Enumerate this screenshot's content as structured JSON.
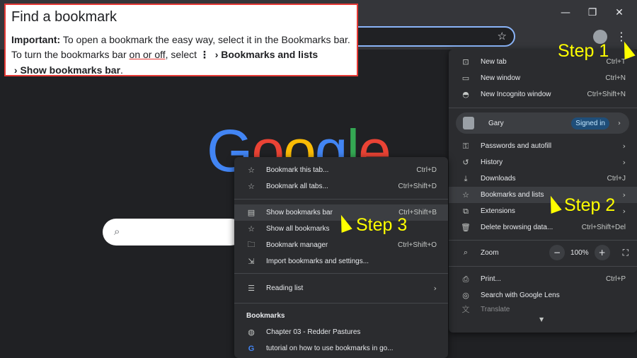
{
  "window": {
    "min_icon": "minimize-icon",
    "restore_icon": "restore-icon",
    "close_icon": "close-icon"
  },
  "help": {
    "title": "Find a bookmark",
    "important_label": "Important:",
    "line1": " To open a bookmark the easy way, select it in the Bookmarks bar.",
    "line2a": "To turn the bookmarks bar ",
    "line2_link": "on or off",
    "line2b": ", select ",
    "line2_menu": "Bookmarks and lists",
    "line3": "Show bookmarks bar",
    "line3_end": "."
  },
  "main_menu": {
    "items": [
      {
        "label": "New tab",
        "shortcut": "Ctrl+T",
        "icon": "new-tab-icon"
      },
      {
        "label": "New window",
        "shortcut": "Ctrl+N",
        "icon": "new-window-icon"
      },
      {
        "label": "New Incognito window",
        "shortcut": "Ctrl+Shift+N",
        "icon": "incognito-icon"
      }
    ],
    "profile": {
      "name": "Gary",
      "badge": "Signed in"
    },
    "items2": [
      {
        "label": "Passwords and autofill",
        "icon": "key-icon"
      },
      {
        "label": "History",
        "icon": "history-icon"
      },
      {
        "label": "Downloads",
        "shortcut": "Ctrl+J",
        "icon": "download-icon"
      },
      {
        "label": "Bookmarks and lists",
        "icon": "star-icon"
      },
      {
        "label": "Extensions",
        "icon": "puzzle-icon"
      },
      {
        "label": "Delete browsing data...",
        "shortcut": "Ctrl+Shift+Del",
        "icon": "trash-icon"
      }
    ],
    "zoom": {
      "label": "Zoom",
      "minus": "−",
      "value": "100%",
      "plus": "+"
    },
    "items3": [
      {
        "label": "Print...",
        "shortcut": "Ctrl+P",
        "icon": "print-icon"
      },
      {
        "label": "Search with Google Lens",
        "icon": "lens-icon"
      },
      {
        "label": "Translate",
        "icon": "translate-icon"
      }
    ]
  },
  "sub_menu": {
    "items": [
      {
        "label": "Bookmark this tab...",
        "shortcut": "Ctrl+D"
      },
      {
        "label": "Bookmark all tabs...",
        "shortcut": "Ctrl+Shift+D"
      },
      {
        "label": "Show bookmarks bar",
        "shortcut": "Ctrl+Shift+B"
      },
      {
        "label": "Show all bookmarks"
      },
      {
        "label": "Bookmark manager",
        "shortcut": "Ctrl+Shift+O"
      },
      {
        "label": "Import bookmarks and settings..."
      },
      {
        "label": "Reading list"
      }
    ],
    "section_title": "Bookmarks",
    "bookmarks": [
      {
        "label": "Chapter 03 - Redder Pastures"
      },
      {
        "label": "tutorial on how to use bookmarks in go..."
      }
    ]
  },
  "steps": {
    "s1": "Step 1",
    "s2": "Step 2",
    "s3": "Step 3"
  },
  "colors": {
    "step": "#ffff00",
    "highlight_border": "#e53935",
    "signed_in_bg": "#1f4e79"
  }
}
